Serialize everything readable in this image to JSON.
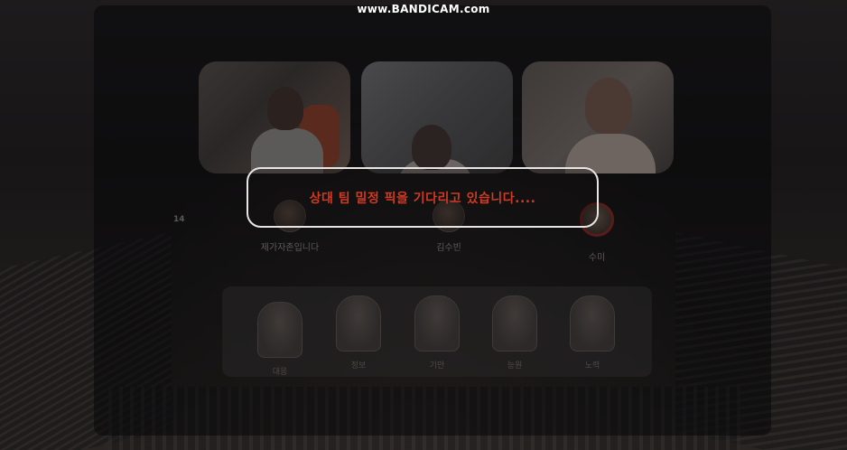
{
  "watermark": "www.BANDICAM.com",
  "timer": "14",
  "modal": {
    "message": "상대 팀 밀정 픽을 기다리고 있습니다...."
  },
  "video_tiles": [
    {
      "name": "video-tile-1"
    },
    {
      "name": "video-tile-2"
    },
    {
      "name": "video-tile-3"
    }
  ],
  "players": [
    {
      "name": "제가자존입니다"
    },
    {
      "name": "김수빈"
    },
    {
      "name": "수미"
    }
  ],
  "characters": [
    {
      "label": "대응"
    },
    {
      "label": "정보"
    },
    {
      "label": "기만"
    },
    {
      "label": "능원"
    },
    {
      "label": "노력"
    }
  ],
  "colors": {
    "modal_text": "#cf3a22",
    "modal_border": "#e8e6e4",
    "active_ring": "#5a1c1a"
  }
}
